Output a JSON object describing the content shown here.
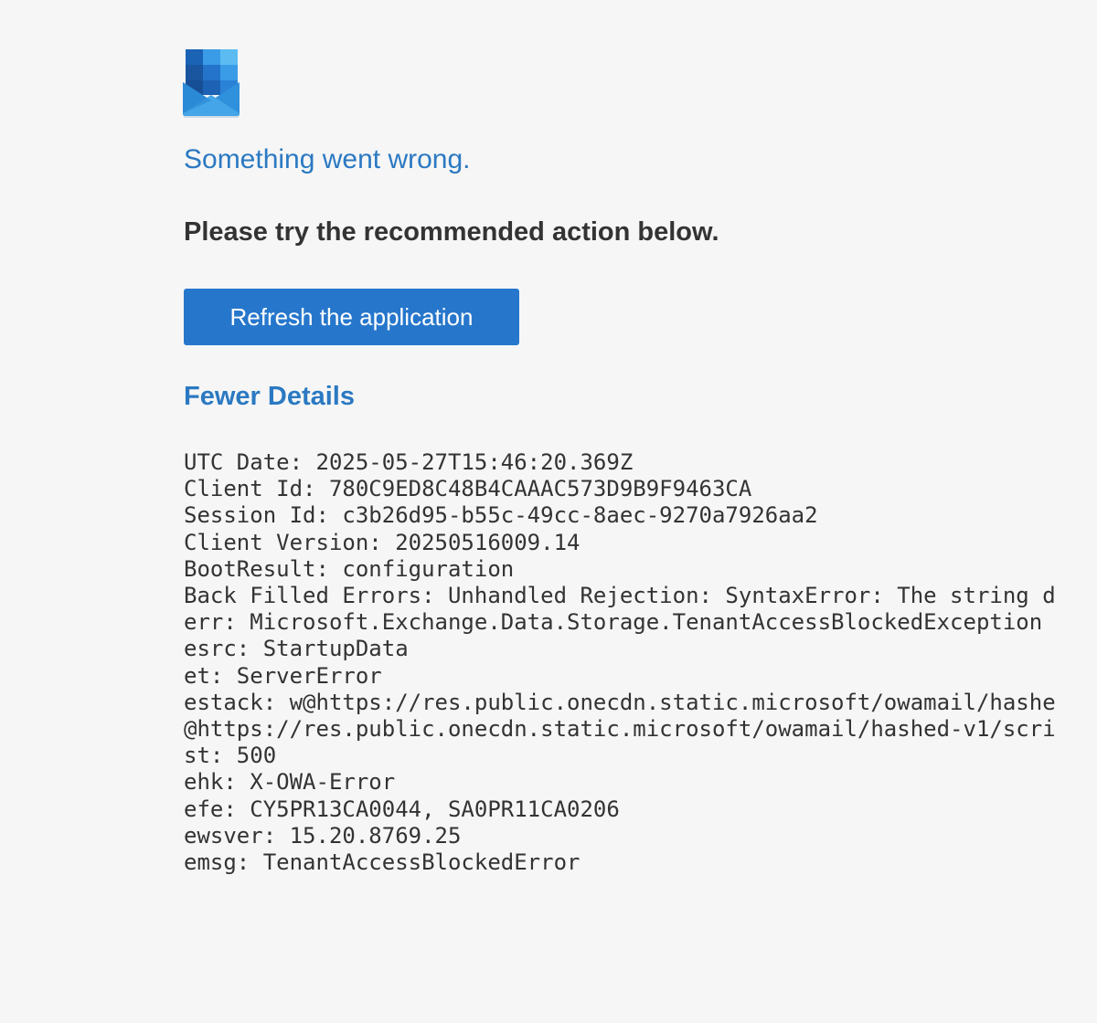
{
  "logo": {
    "icon": "outlook-mail-icon",
    "colors": {
      "dark_blue": "#1a5aa6",
      "mid_blue": "#2b7fd4",
      "light_blue": "#58b4ee",
      "envelope": "#2f91dc",
      "envelope_flap": "#1f6fc0"
    }
  },
  "error": {
    "title": "Something went wrong.",
    "subtitle": "Please try the recommended action below."
  },
  "actions": {
    "refresh_label": "Refresh the application",
    "details_toggle_label": "Fewer Details"
  },
  "details": [
    "UTC Date: 2025-05-27T15:46:20.369Z",
    "Client Id: 780C9ED8C48B4CAAAC573D9B9F9463CA",
    "Session Id: c3b26d95-b55c-49cc-8aec-9270a7926aa2",
    "Client Version: 20250516009.14",
    "BootResult: configuration",
    "Back Filled Errors: Unhandled Rejection: SyntaxError: The string d",
    "err: Microsoft.Exchange.Data.Storage.TenantAccessBlockedException",
    "esrc: StartupData",
    "et: ServerError",
    "estack: w@https://res.public.onecdn.static.microsoft/owamail/hashe",
    "@https://res.public.onecdn.static.microsoft/owamail/hashed-v1/scri",
    "st: 500",
    "ehk: X-OWA-Error",
    "efe: CY5PR13CA0044, SA0PR11CA0206",
    "ewsver: 15.20.8769.25",
    "emsg: TenantAccessBlockedError"
  ],
  "theme": {
    "background": "#f6f6f6",
    "accent": "#2b79c2",
    "button": "#2677cc",
    "text": "#333333"
  }
}
